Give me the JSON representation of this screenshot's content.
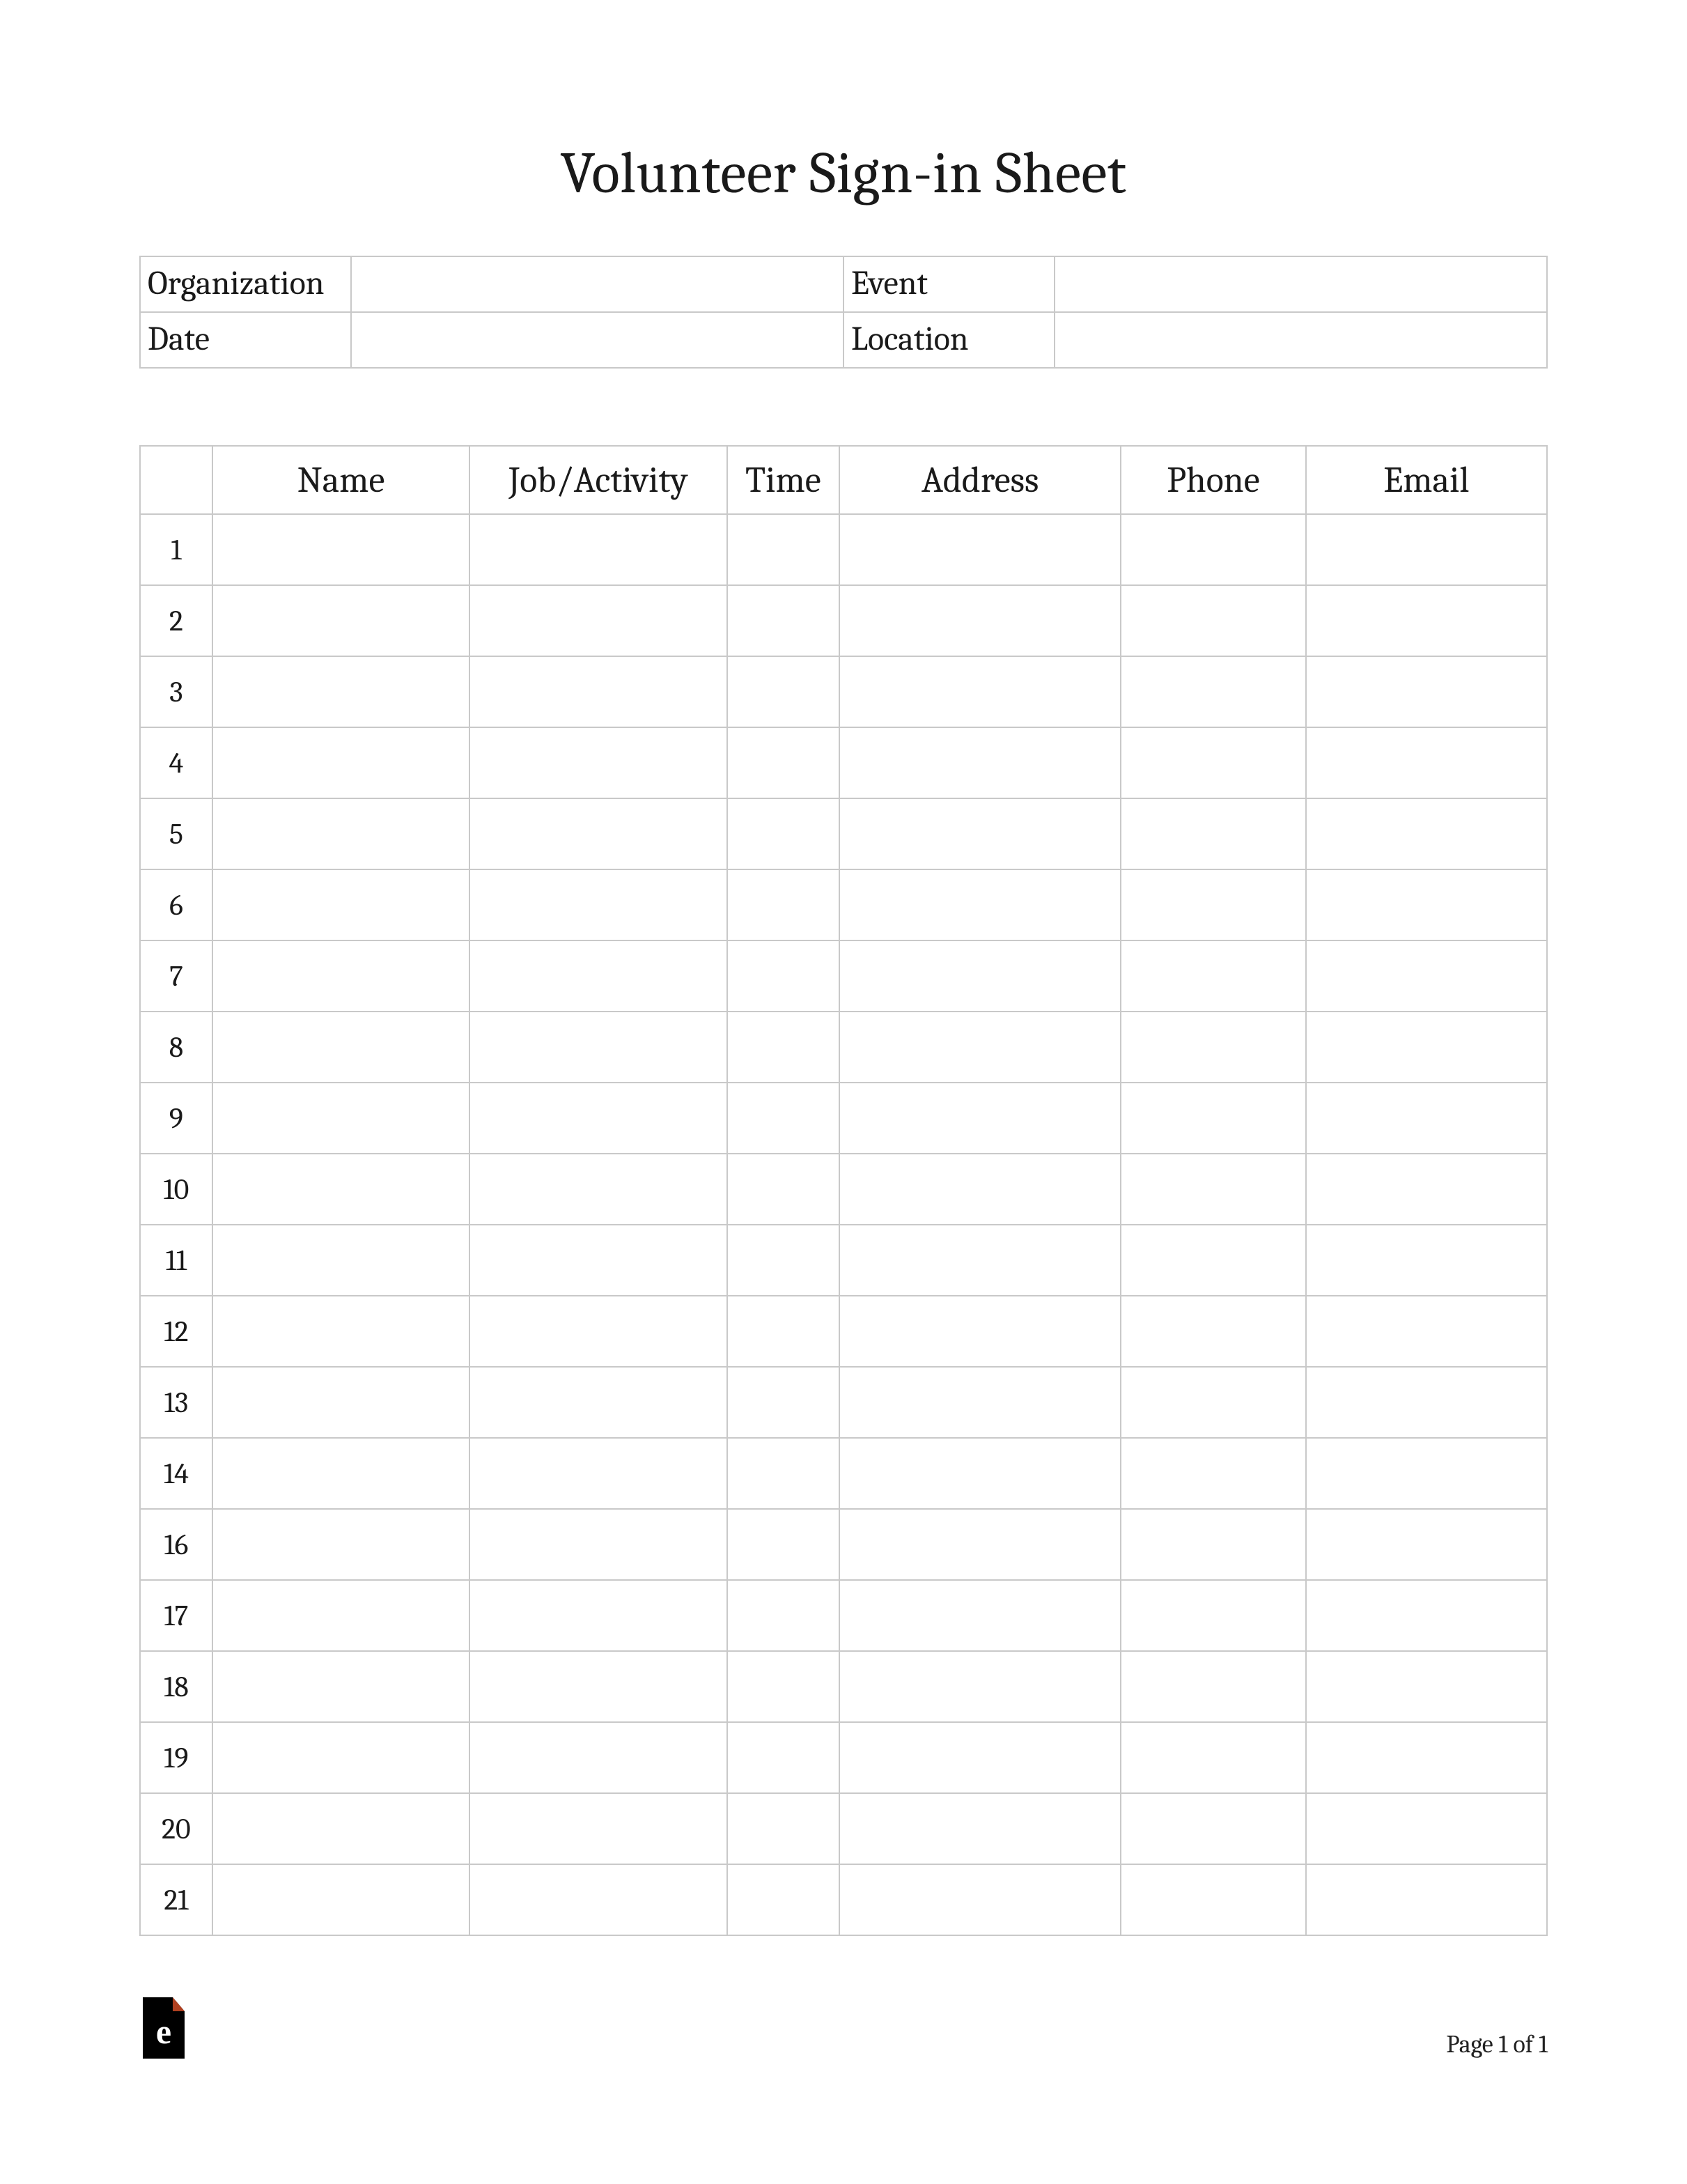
{
  "title": "Volunteer Sign-in Sheet",
  "info": {
    "organization_label": "Organization",
    "organization_value": "",
    "event_label": "Event",
    "event_value": "",
    "date_label": "Date",
    "date_value": "",
    "location_label": "Location",
    "location_value": ""
  },
  "columns": {
    "num": "",
    "name": "Name",
    "job": "Job/Activity",
    "time": "Time",
    "address": "Address",
    "phone": "Phone",
    "email": "Email"
  },
  "rows": [
    {
      "num": "1",
      "name": "",
      "job": "",
      "time": "",
      "address": "",
      "phone": "",
      "email": ""
    },
    {
      "num": "2",
      "name": "",
      "job": "",
      "time": "",
      "address": "",
      "phone": "",
      "email": ""
    },
    {
      "num": "3",
      "name": "",
      "job": "",
      "time": "",
      "address": "",
      "phone": "",
      "email": ""
    },
    {
      "num": "4",
      "name": "",
      "job": "",
      "time": "",
      "address": "",
      "phone": "",
      "email": ""
    },
    {
      "num": "5",
      "name": "",
      "job": "",
      "time": "",
      "address": "",
      "phone": "",
      "email": ""
    },
    {
      "num": "6",
      "name": "",
      "job": "",
      "time": "",
      "address": "",
      "phone": "",
      "email": ""
    },
    {
      "num": "7",
      "name": "",
      "job": "",
      "time": "",
      "address": "",
      "phone": "",
      "email": ""
    },
    {
      "num": "8",
      "name": "",
      "job": "",
      "time": "",
      "address": "",
      "phone": "",
      "email": ""
    },
    {
      "num": "9",
      "name": "",
      "job": "",
      "time": "",
      "address": "",
      "phone": "",
      "email": ""
    },
    {
      "num": "10",
      "name": "",
      "job": "",
      "time": "",
      "address": "",
      "phone": "",
      "email": ""
    },
    {
      "num": "11",
      "name": "",
      "job": "",
      "time": "",
      "address": "",
      "phone": "",
      "email": ""
    },
    {
      "num": "12",
      "name": "",
      "job": "",
      "time": "",
      "address": "",
      "phone": "",
      "email": ""
    },
    {
      "num": "13",
      "name": "",
      "job": "",
      "time": "",
      "address": "",
      "phone": "",
      "email": ""
    },
    {
      "num": "14",
      "name": "",
      "job": "",
      "time": "",
      "address": "",
      "phone": "",
      "email": ""
    },
    {
      "num": "16",
      "name": "",
      "job": "",
      "time": "",
      "address": "",
      "phone": "",
      "email": ""
    },
    {
      "num": "17",
      "name": "",
      "job": "",
      "time": "",
      "address": "",
      "phone": "",
      "email": ""
    },
    {
      "num": "18",
      "name": "",
      "job": "",
      "time": "",
      "address": "",
      "phone": "",
      "email": ""
    },
    {
      "num": "19",
      "name": "",
      "job": "",
      "time": "",
      "address": "",
      "phone": "",
      "email": ""
    },
    {
      "num": "20",
      "name": "",
      "job": "",
      "time": "",
      "address": "",
      "phone": "",
      "email": ""
    },
    {
      "num": "21",
      "name": "",
      "job": "",
      "time": "",
      "address": "",
      "phone": "",
      "email": ""
    }
  ],
  "footer": {
    "page_label": "Page 1 of 1"
  }
}
